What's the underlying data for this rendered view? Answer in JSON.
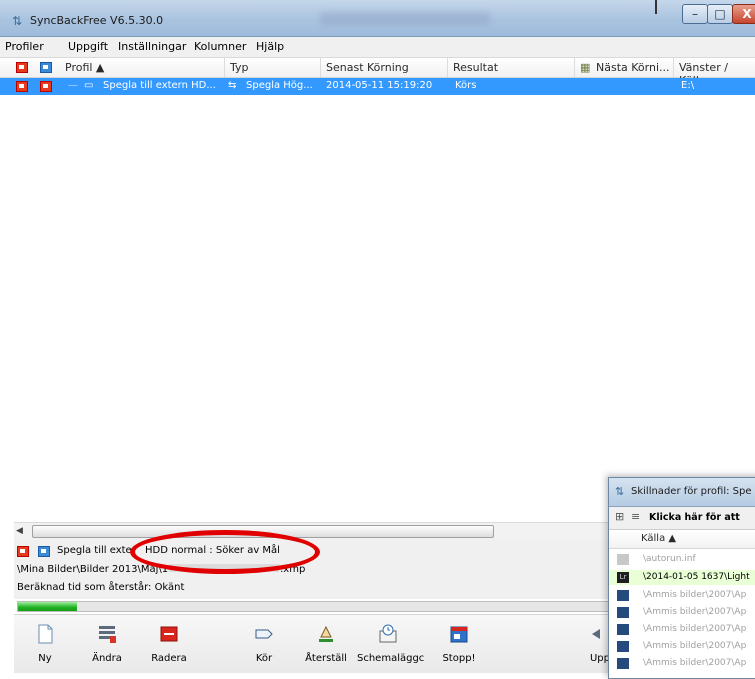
{
  "window": {
    "title": "SyncBackFree V6.5.30.0",
    "buttons": {
      "minimize": "–",
      "maximize": "□",
      "close": "X"
    }
  },
  "menu": [
    "Profiler",
    "Uppgift",
    "Inställningar",
    "Kolumner",
    "Hjälp"
  ],
  "columns": [
    "Profil",
    "Typ",
    "Senast Körning",
    "Resultat",
    "Nästa Körni...",
    "Vänster / Källa"
  ],
  "row": {
    "profile": "Spegla till extern HD...",
    "type": "Spegla Hög...",
    "last_run": "2014-05-11 15:19:20",
    "result": "Körs",
    "next_run": "",
    "source": "E:\\"
  },
  "status": {
    "line1_prefix": "Spegla till exter",
    "line1_suffix": "HDD normal : Söker av Mål",
    "line2_prefix": "\\Mina Bilder\\Bilder 2013\\Maj\\1",
    "line2_suffix": ".xmp",
    "line3": "Beräknad tid som återstår: Okänt",
    "progress": 0.08
  },
  "toolbar": [
    {
      "label": "Ny",
      "icon": "new-document-icon"
    },
    {
      "label": "Ändra",
      "icon": "modify-icon"
    },
    {
      "label": "Radera",
      "icon": "delete-icon"
    },
    {
      "label": "Kör",
      "icon": "run-icon"
    },
    {
      "label": "Återställ",
      "icon": "restore-icon"
    },
    {
      "label": "Schemaläggc",
      "icon": "schedule-icon"
    },
    {
      "label": "Stopp!",
      "icon": "stop-icon"
    },
    {
      "label": "Upp",
      "icon": "upgrade-icon"
    }
  ],
  "secondary": {
    "title": "Skillnader för profil: Spe",
    "click_text": "Klicka här för att",
    "column": "Källa",
    "rows": [
      "\\autorun.inf",
      "\\2014-01-05 1637\\Light",
      "\\Ammis bilder\\2007\\Ap",
      "\\Ammis bilder\\2007\\Ap",
      "\\Ammis bilder\\2007\\Ap",
      "\\Ammis bilder\\2007\\Ap",
      "\\Ammis bilder\\2007\\Ap"
    ]
  },
  "colors": {
    "selection": "#3399ff",
    "highlight_ring": "#e00000",
    "progress": "#20b020"
  }
}
